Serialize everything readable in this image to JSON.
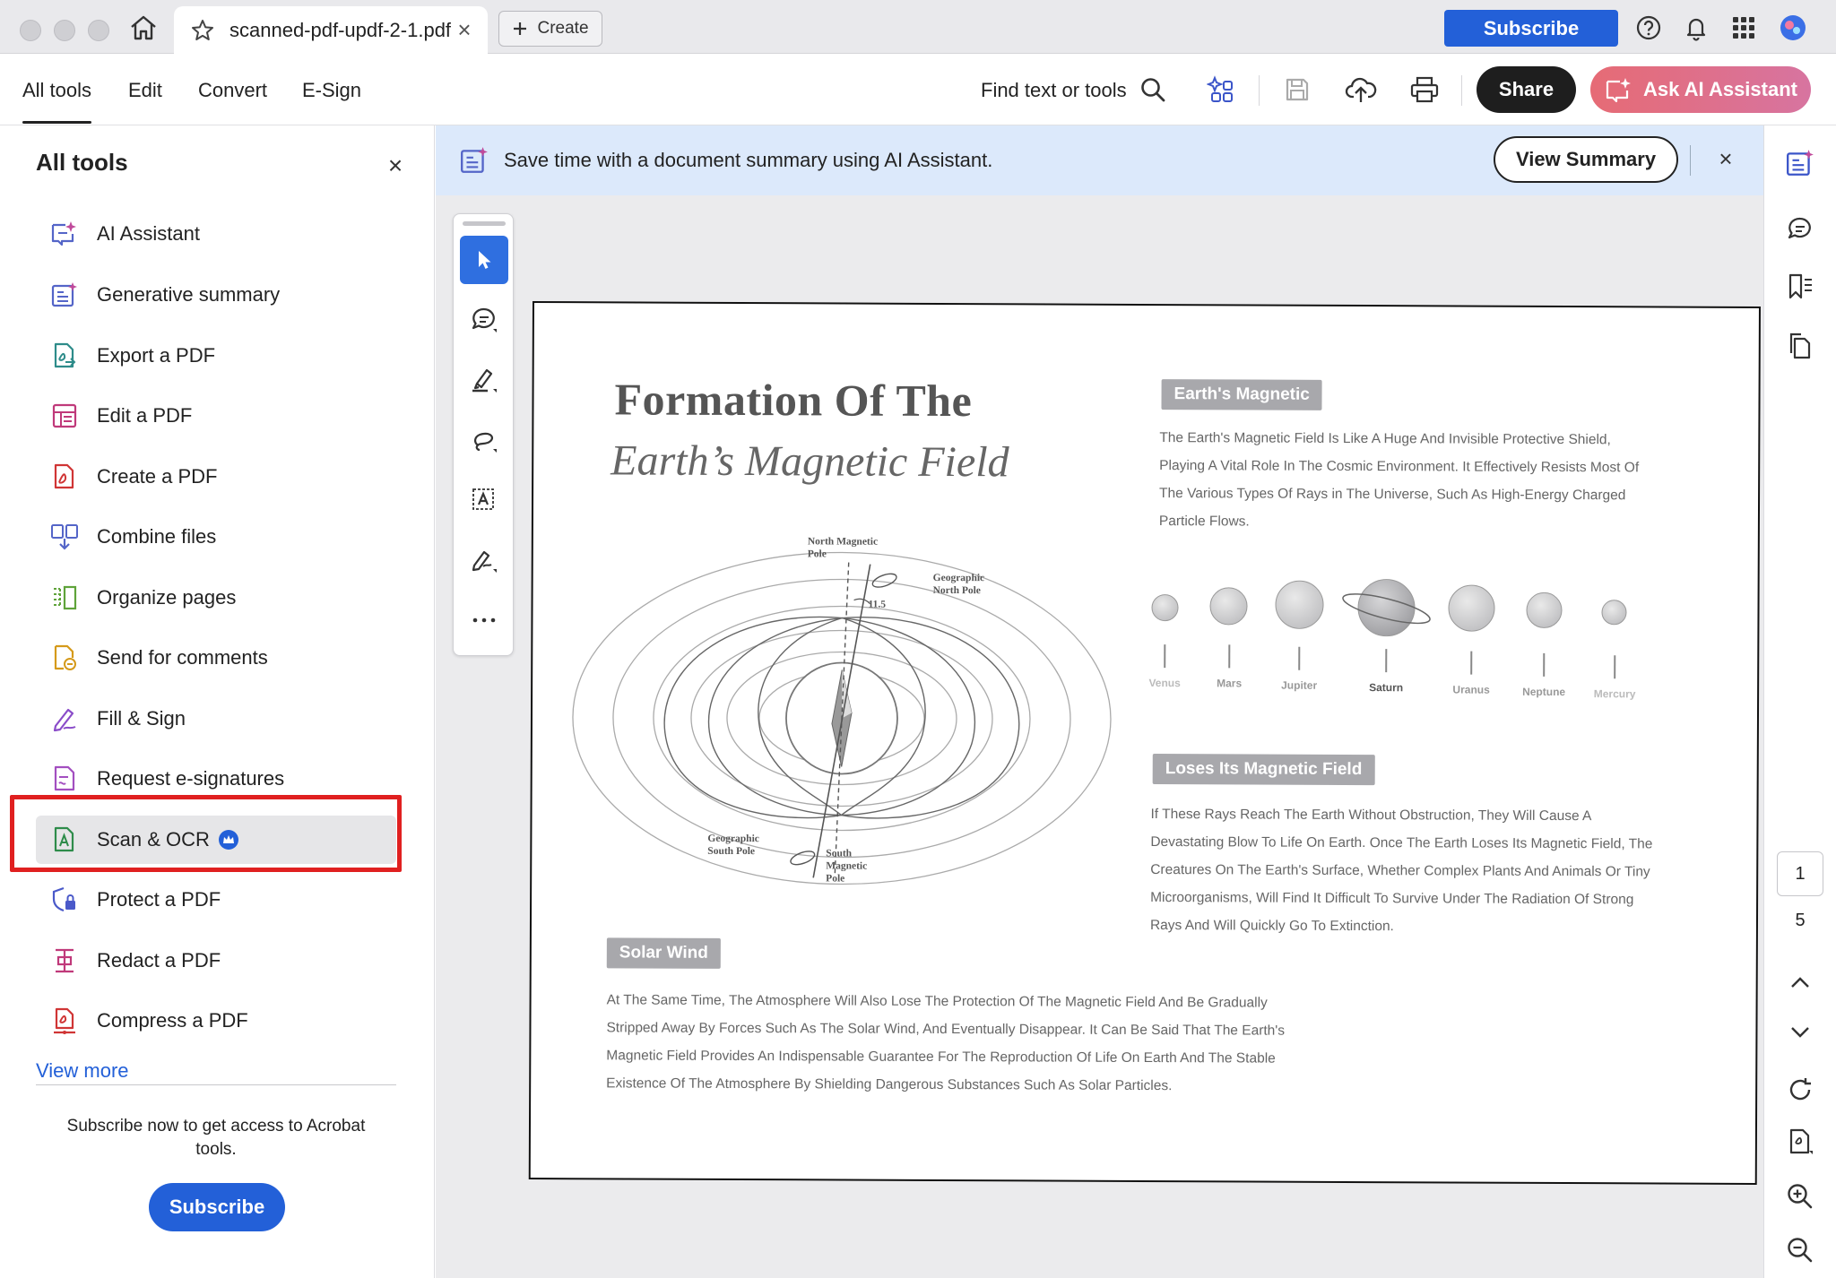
{
  "titlebar": {
    "tab_title": "scanned-pdf-updf-2-1.pdf",
    "tab_close": "×",
    "create_label": "Create",
    "subscribe_label": "Subscribe"
  },
  "menubar": {
    "items": [
      "All tools",
      "Edit",
      "Convert",
      "E-Sign"
    ],
    "find_label": "Find text or tools",
    "share_label": "Share",
    "ask_ai_label": "Ask AI Assistant"
  },
  "leftpanel": {
    "title": "All tools",
    "close": "×",
    "tools": [
      {
        "label": "AI Assistant",
        "icon": "ai-assistant-icon"
      },
      {
        "label": "Generative summary",
        "icon": "generative-summary-icon"
      },
      {
        "label": "Export a PDF",
        "icon": "export-pdf-icon"
      },
      {
        "label": "Edit a PDF",
        "icon": "edit-pdf-icon"
      },
      {
        "label": "Create a PDF",
        "icon": "create-pdf-icon"
      },
      {
        "label": "Combine files",
        "icon": "combine-files-icon"
      },
      {
        "label": "Organize pages",
        "icon": "organize-pages-icon"
      },
      {
        "label": "Send for comments",
        "icon": "send-comments-icon"
      },
      {
        "label": "Fill & Sign",
        "icon": "fill-sign-icon"
      },
      {
        "label": "Request e-signatures",
        "icon": "request-esign-icon"
      },
      {
        "label": "Scan & OCR",
        "icon": "scan-ocr-icon"
      },
      {
        "label": "Protect a PDF",
        "icon": "protect-pdf-icon"
      },
      {
        "label": "Redact a PDF",
        "icon": "redact-pdf-icon"
      },
      {
        "label": "Compress a PDF",
        "icon": "compress-pdf-icon"
      }
    ],
    "view_more": "View more",
    "promo_text": "Subscribe now to get access to Acrobat tools.",
    "subscribe_label": "Subscribe"
  },
  "banner": {
    "text": "Save time with a document summary using AI Assistant.",
    "view_summary": "View Summary",
    "close": "×"
  },
  "document": {
    "title_line1": "Formation Of The",
    "title_line2": "Earth’s Magnetic Field",
    "section1_tag": "Earth's Magnetic",
    "section1_text": "The Earth's Magnetic Field Is Like A Huge And Invisible Protective Shield, Playing A Vital Role In The Cosmic Environment. It Effectively Resists Most Of The Various Types Of Rays in The Universe, Such As High-Energy Charged Particle Flows.",
    "planets": [
      "Venus",
      "Mars",
      "Jupiter",
      "Saturn",
      "Uranus",
      "Neptune",
      "Mercury"
    ],
    "section2_tag": "Loses Its Magnetic Field",
    "section2_text": "If These Rays Reach The Earth Without Obstruction, They Will Cause A Devastating Blow To Life On Earth. Once The Earth Loses Its Magnetic Field, The Creatures On The Earth's Surface, Whether Complex Plants And Animals Or Tiny Microorganisms, Will Find It Difficult To Survive Under The Radiation Of Strong Rays And Will Quickly Go To Extinction.",
    "section3_tag": "Solar Wind",
    "section3_text": "At The Same Time, The Atmosphere Will Also Lose The Protection Of The Magnetic Field And Be Gradually Stripped Away By Forces Such As The Solar Wind, And Eventually Disappear. It Can Be Said That The Earth's Magnetic Field Provides An Indispensable Guarantee For The Reproduction Of Life On Earth And The Stable Existence Of The Atmosphere By Shielding Dangerous Substances Such As Solar Particles.",
    "diagram": {
      "north_magnetic": "North Magnetic Pole",
      "geo_north": "Geographic North Pole",
      "angle": "11.5",
      "geo_south": "Geographic South Pole",
      "south_magnetic": "South Magnetic Pole"
    }
  },
  "pager": {
    "current": "1",
    "total": "5"
  },
  "colors": {
    "accent_blue": "#2360d8",
    "highlight_red": "#e02020",
    "banner_bg": "#dce9fb"
  }
}
